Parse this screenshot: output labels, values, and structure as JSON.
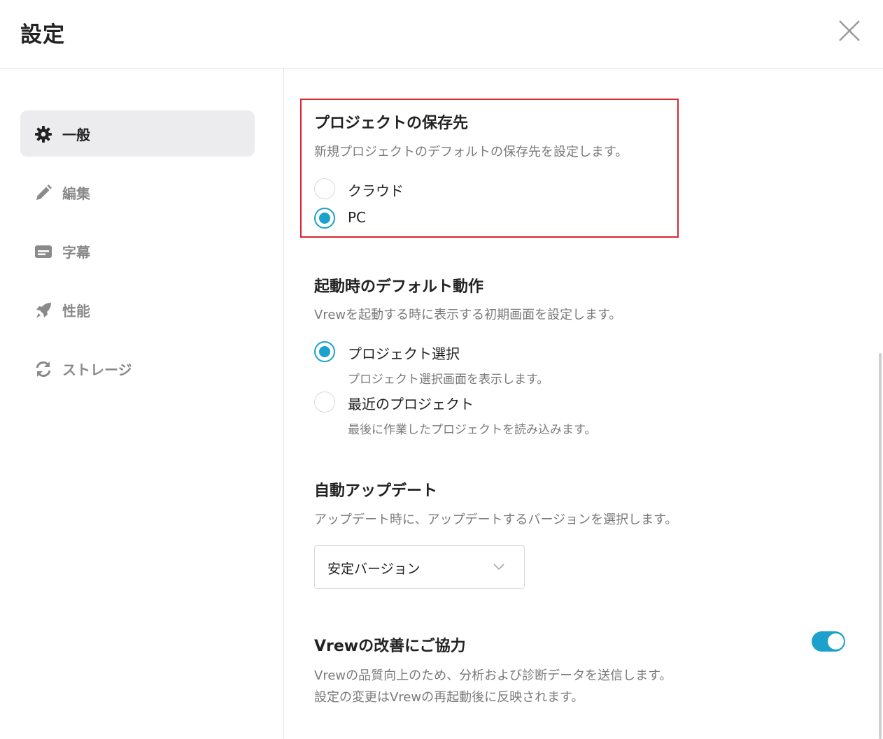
{
  "header": {
    "title": "設定"
  },
  "sidebar": {
    "items": [
      {
        "label": "一般",
        "icon": "gear-icon",
        "active": true
      },
      {
        "label": "編集",
        "icon": "pencil-icon",
        "active": false
      },
      {
        "label": "字幕",
        "icon": "subtitle-icon",
        "active": false
      },
      {
        "label": "性能",
        "icon": "rocket-icon",
        "active": false
      },
      {
        "label": "ストレージ",
        "icon": "sync-icon",
        "active": false
      }
    ]
  },
  "save_location": {
    "title": "プロジェクトの保存先",
    "description": "新規プロジェクトのデフォルトの保存先を設定します。",
    "options": [
      {
        "label": "クラウド",
        "checked": false
      },
      {
        "label": "PC",
        "checked": true
      }
    ]
  },
  "startup": {
    "title": "起動時のデフォルト動作",
    "description": "Vrewを起動する時に表示する初期画面を設定します。",
    "options": [
      {
        "label": "プロジェクト選択",
        "sub": "プロジェクト選択画面を表示します。",
        "checked": true
      },
      {
        "label": "最近のプロジェクト",
        "sub": "最後に作業したプロジェクトを読み込みます。",
        "checked": false
      }
    ]
  },
  "auto_update": {
    "title": "自動アップデート",
    "description": "アップデート時に、アップデートするバージョンを選択します。",
    "selected": "安定バージョン"
  },
  "improve": {
    "title": "Vrewの改善にご協力",
    "description_line1": "Vrewの品質向上のため、分析および診断データを送信します。",
    "description_line2": "設定の変更はVrewの再起動後に反映されます。",
    "enabled": true
  },
  "colors": {
    "accent": "#1ba1cc",
    "highlight_border": "#d92630"
  }
}
